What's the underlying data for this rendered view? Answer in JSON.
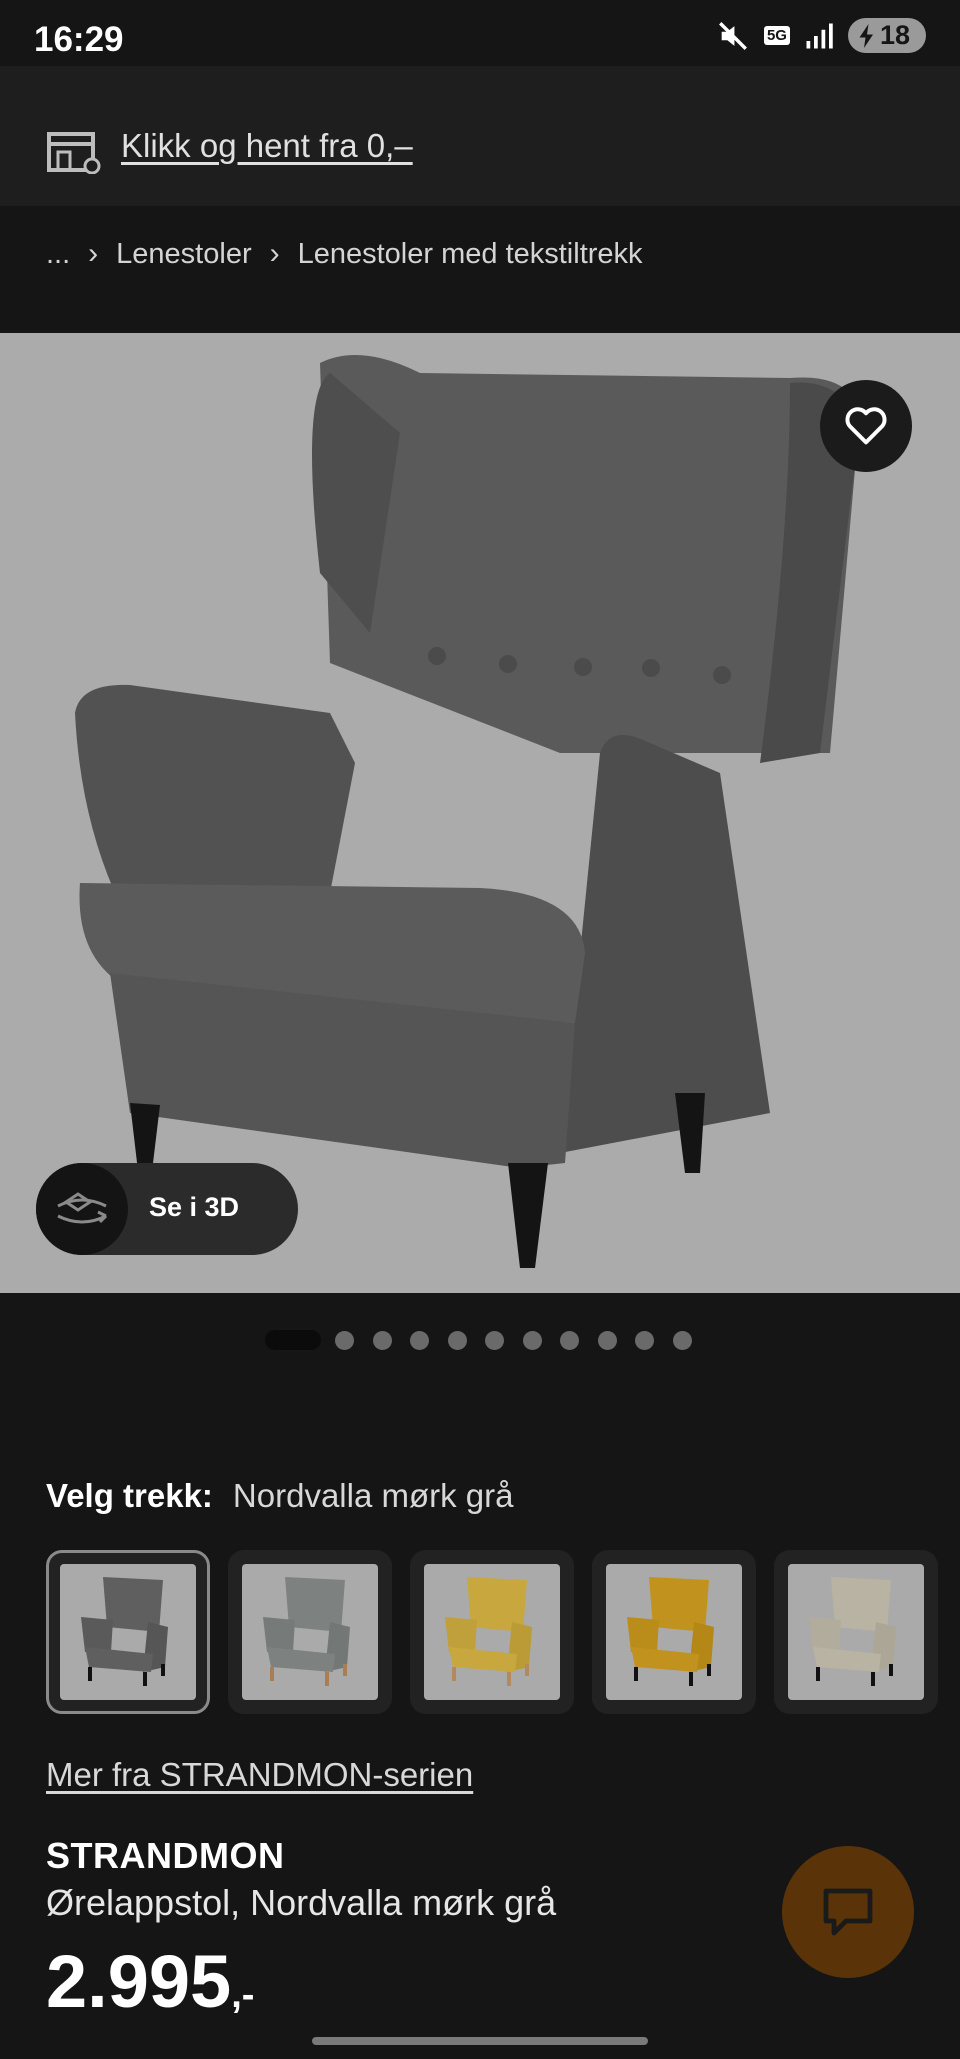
{
  "status_bar": {
    "time": "16:29",
    "network": "5G",
    "battery": "18"
  },
  "promo": {
    "link_text": "Klikk og hent fra 0,–"
  },
  "breadcrumb": {
    "ellipsis": "...",
    "items": [
      "Lenestoler",
      "Lenestoler med tekstiltrekk"
    ]
  },
  "gallery": {
    "view_3d_label": "Se i 3D",
    "dot_count": 11,
    "active_index": 0
  },
  "cover": {
    "label": "Velg trekk:",
    "selected_value": "Nordvalla mørk grå",
    "swatch_colors": [
      "#5f5f60",
      "#7d8280",
      "#c7a73e",
      "#c1931e",
      "#b9b3a3"
    ]
  },
  "series_link": "Mer fra STRANDMON-serien",
  "product": {
    "name": "STRANDMON",
    "description": "Ørelappstol, Nordvalla mørk grå",
    "price": "2.995",
    "price_suffix": ",-"
  },
  "colors": {
    "background": "#151515",
    "image_bg": "#ababab",
    "chat_fab": "#5a3408"
  }
}
